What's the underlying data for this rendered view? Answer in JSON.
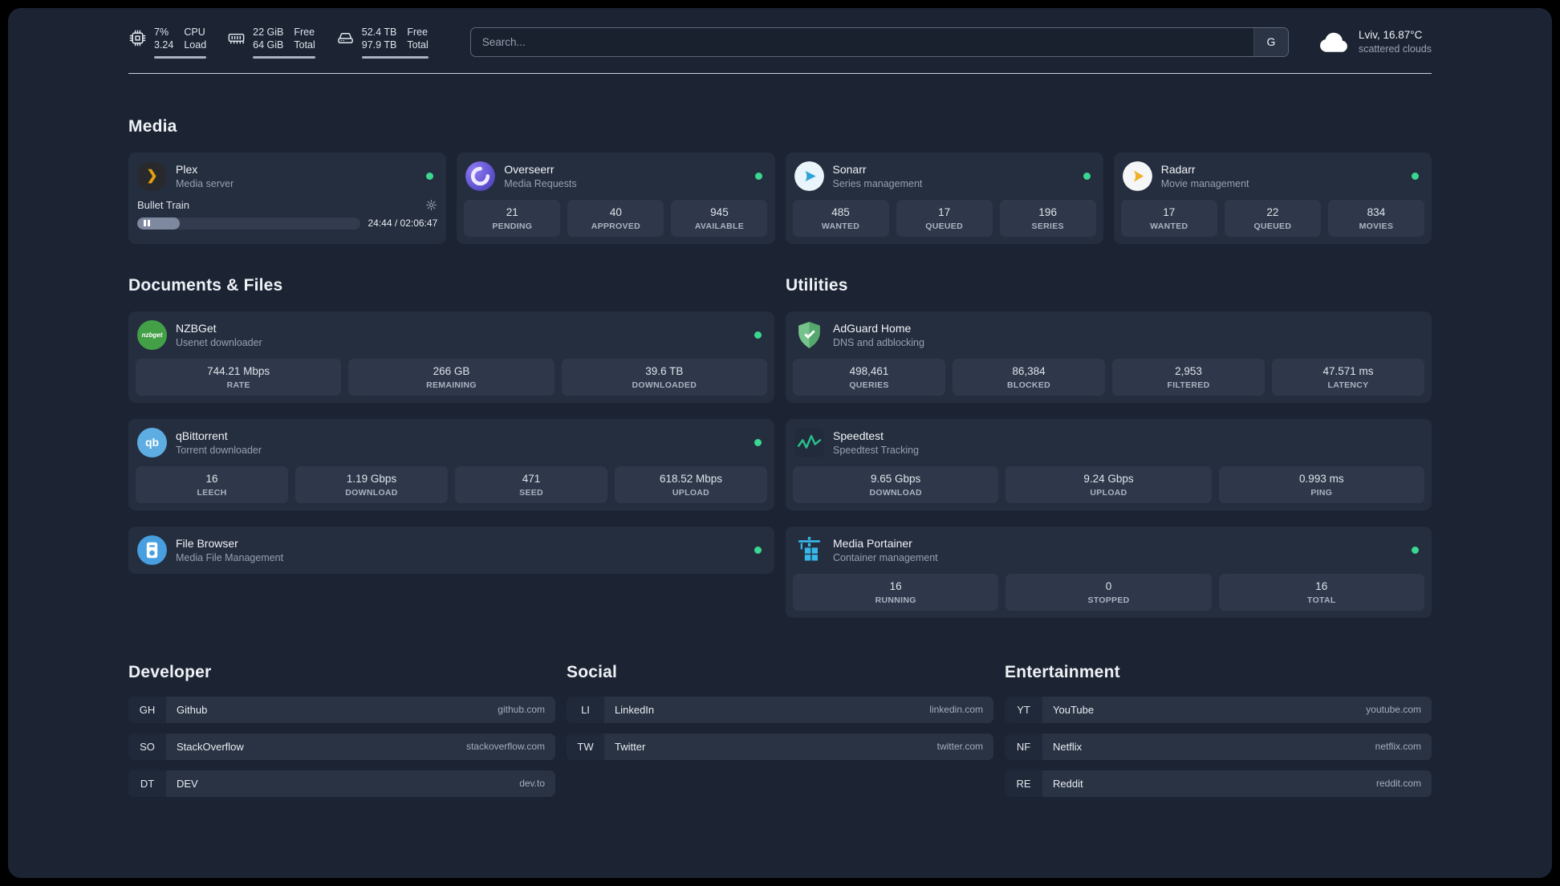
{
  "topbar": {
    "cpu": {
      "value1": "7%",
      "value2": "3.24",
      "label1": "CPU",
      "label2": "Load"
    },
    "memory": {
      "value1": "22 GiB",
      "value2": "64 GiB",
      "label1": "Free",
      "label2": "Total"
    },
    "disk": {
      "value1": "52.4 TB",
      "value2": "97.9 TB",
      "label1": "Free",
      "label2": "Total"
    },
    "search": {
      "placeholder": "Search...",
      "button_label": "G"
    },
    "weather": {
      "location": "Lviv, 16.87°C",
      "condition": "scattered clouds"
    }
  },
  "sections": {
    "media": {
      "title": "Media"
    },
    "documents": {
      "title": "Documents & Files"
    },
    "utilities": {
      "title": "Utilities"
    },
    "developer": {
      "title": "Developer"
    },
    "social": {
      "title": "Social"
    },
    "entertainment": {
      "title": "Entertainment"
    }
  },
  "icons": {
    "plex_glyph": "❯"
  },
  "services": {
    "plex": {
      "name": "Plex",
      "subtitle": "Media server",
      "now_playing": "Bullet Train",
      "time": "24:44 / 02:06:47",
      "progress_percent": 19
    },
    "overseerr": {
      "name": "Overseerr",
      "subtitle": "Media Requests",
      "stats": [
        {
          "value": "21",
          "label": "PENDING"
        },
        {
          "value": "40",
          "label": "APPROVED"
        },
        {
          "value": "945",
          "label": "AVAILABLE"
        }
      ]
    },
    "sonarr": {
      "name": "Sonarr",
      "subtitle": "Series management",
      "stats": [
        {
          "value": "485",
          "label": "WANTED"
        },
        {
          "value": "17",
          "label": "QUEUED"
        },
        {
          "value": "196",
          "label": "SERIES"
        }
      ]
    },
    "radarr": {
      "name": "Radarr",
      "subtitle": "Movie management",
      "stats": [
        {
          "value": "17",
          "label": "WANTED"
        },
        {
          "value": "22",
          "label": "QUEUED"
        },
        {
          "value": "834",
          "label": "MOVIES"
        }
      ]
    },
    "nzbget": {
      "name": "NZBGet",
      "subtitle": "Usenet downloader",
      "icon_text": "nzbget",
      "stats": [
        {
          "value": "744.21 Mbps",
          "label": "RATE"
        },
        {
          "value": "266 GB",
          "label": "REMAINING"
        },
        {
          "value": "39.6 TB",
          "label": "DOWNLOADED"
        }
      ]
    },
    "qbittorrent": {
      "name": "qBittorrent",
      "subtitle": "Torrent downloader",
      "icon_text": "qb",
      "stats": [
        {
          "value": "16",
          "label": "LEECH"
        },
        {
          "value": "1.19 Gbps",
          "label": "DOWNLOAD"
        },
        {
          "value": "471",
          "label": "SEED"
        },
        {
          "value": "618.52 Mbps",
          "label": "UPLOAD"
        }
      ]
    },
    "filebrowser": {
      "name": "File Browser",
      "subtitle": "Media File Management"
    },
    "adguard": {
      "name": "AdGuard Home",
      "subtitle": "DNS and adblocking",
      "stats": [
        {
          "value": "498,461",
          "label": "QUERIES"
        },
        {
          "value": "86,384",
          "label": "BLOCKED"
        },
        {
          "value": "2,953",
          "label": "FILTERED"
        },
        {
          "value": "47.571 ms",
          "label": "LATENCY"
        }
      ]
    },
    "speedtest": {
      "name": "Speedtest",
      "subtitle": "Speedtest Tracking",
      "stats": [
        {
          "value": "9.65 Gbps",
          "label": "DOWNLOAD"
        },
        {
          "value": "9.24 Gbps",
          "label": "UPLOAD"
        },
        {
          "value": "0.993 ms",
          "label": "PING"
        }
      ]
    },
    "portainer": {
      "name": "Media Portainer",
      "subtitle": "Container management",
      "stats": [
        {
          "value": "16",
          "label": "RUNNING"
        },
        {
          "value": "0",
          "label": "STOPPED"
        },
        {
          "value": "16",
          "label": "TOTAL"
        }
      ]
    }
  },
  "bookmarks": {
    "developer": [
      {
        "abbr": "GH",
        "name": "Github",
        "url": "github.com"
      },
      {
        "abbr": "SO",
        "name": "StackOverflow",
        "url": "stackoverflow.com"
      },
      {
        "abbr": "DT",
        "name": "DEV",
        "url": "dev.to"
      }
    ],
    "social": [
      {
        "abbr": "LI",
        "name": "LinkedIn",
        "url": "linkedin.com"
      },
      {
        "abbr": "TW",
        "name": "Twitter",
        "url": "twitter.com"
      }
    ],
    "entertainment": [
      {
        "abbr": "YT",
        "name": "YouTube",
        "url": "youtube.com"
      },
      {
        "abbr": "NF",
        "name": "Netflix",
        "url": "netflix.com"
      },
      {
        "abbr": "RE",
        "name": "Reddit",
        "url": "reddit.com"
      }
    ]
  },
  "colors": {
    "status_green": "#3bd68f",
    "plex_amber": "#e5a00d",
    "background": "#1c2433"
  }
}
